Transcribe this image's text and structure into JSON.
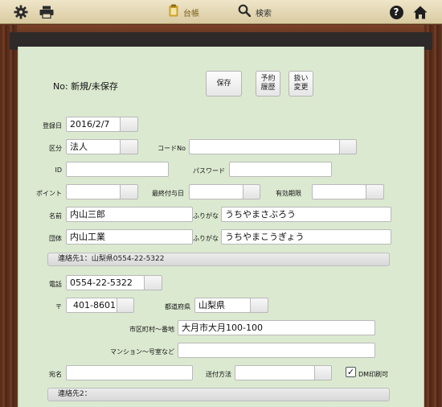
{
  "toolbar": {
    "tab_ledger": "台帳",
    "tab_search": "検索",
    "help": "?"
  },
  "form": {
    "status_text": "No: 新規/未保存",
    "save_label": "保存",
    "reservation_history_label": "予約\n履歴",
    "handling_change_label": "扱い\n変更",
    "reg_date_label": "登録日",
    "reg_date_value": "2016/2/7",
    "category_label": "区分",
    "category_value": "法人",
    "code_label": "コードNo",
    "code_value": "",
    "id_label": "ID",
    "id_value": "",
    "password_label": "パスワード",
    "password_value": "",
    "point_label": "ポイント",
    "point_value": "",
    "last_grant_label": "最終付与日",
    "last_grant_value": "",
    "expiry_label": "有効期限",
    "expiry_value": "",
    "name_label": "名前",
    "name_value": "内山三郎",
    "name_kana_label": "ふりがな",
    "name_kana_value": "うちやまさぶろう",
    "org_label": "団体",
    "org_value": "内山工業",
    "org_kana_label": "ふりがな",
    "org_kana_value": "うちやまこうぎょう",
    "contact1_bar": "連絡先1：山梨県0554-22-5322",
    "phone_label": "電話",
    "phone_value": "0554-22-5322",
    "zip_label": "〒",
    "zip_value": "401-8601",
    "prefecture_label": "都道府県",
    "prefecture_value": "山梨県",
    "city_label": "市区町村～番地",
    "city_value": "大月市大月100-100",
    "building_label": "マンション～号室など",
    "building_value": "",
    "addressee_label": "宛名",
    "addressee_value": "",
    "shipping_label": "送付方法",
    "shipping_value": "",
    "dm_print_label": "DM印刷可",
    "dm_print_check": "✓",
    "contact2_bar": "連絡先2："
  }
}
